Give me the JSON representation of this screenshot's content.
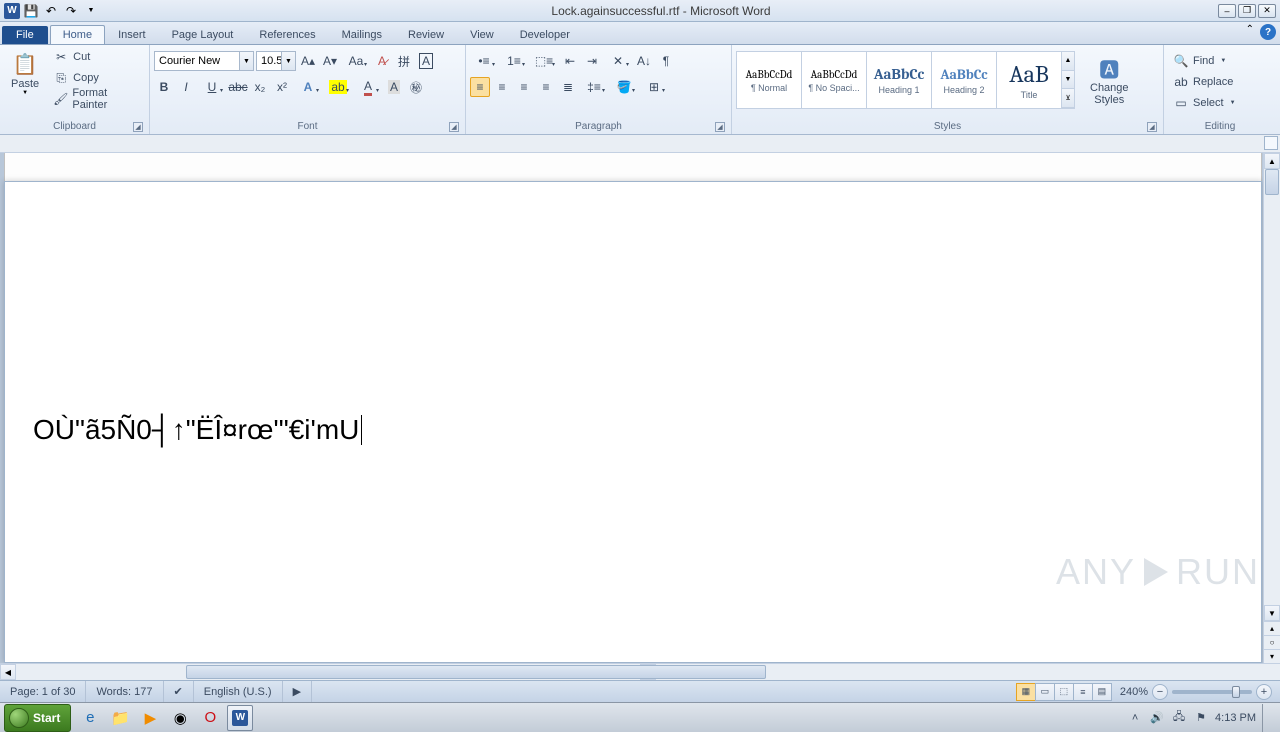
{
  "title": "Lock.againsuccessful.rtf - Microsoft Word",
  "qat": {
    "save": "💾",
    "undo": "↶",
    "redo": "↷"
  },
  "tabs": {
    "file": "File",
    "items": [
      "Home",
      "Insert",
      "Page Layout",
      "References",
      "Mailings",
      "Review",
      "View",
      "Developer"
    ],
    "active": 0
  },
  "clipboard": {
    "label": "Clipboard",
    "paste": "Paste",
    "cut": "Cut",
    "copy": "Copy",
    "format_painter": "Format Painter"
  },
  "font": {
    "label": "Font",
    "name": "Courier New",
    "size": "10.5"
  },
  "paragraph": {
    "label": "Paragraph"
  },
  "styles": {
    "label": "Styles",
    "items": [
      {
        "preview": "AaBbCcDd",
        "name": "¶ Normal",
        "size": "11px",
        "color": "#000"
      },
      {
        "preview": "AaBbCcDd",
        "name": "¶ No Spaci...",
        "size": "11px",
        "color": "#000"
      },
      {
        "preview": "AaBbCc",
        "name": "Heading 1",
        "size": "15px",
        "color": "#365f91"
      },
      {
        "preview": "AaBbCc",
        "name": "Heading 2",
        "size": "14px",
        "color": "#4f81bd"
      },
      {
        "preview": "AaB",
        "name": "Title",
        "size": "24px",
        "color": "#17365d"
      }
    ],
    "change": "Change\nStyles"
  },
  "editing": {
    "label": "Editing",
    "find": "Find",
    "replace": "Replace",
    "select": "Select"
  },
  "document": {
    "text": "OÙ\"ã5Ñ0┤↑\"ËÎ¤rœ'\"€i'mU"
  },
  "status": {
    "page": "Page: 1 of 30",
    "words": "Words: 177",
    "language": "English (U.S.)",
    "zoom": "240%"
  },
  "taskbar": {
    "start": "Start",
    "time": "4:13 PM"
  },
  "watermark": "ANY   RUN"
}
